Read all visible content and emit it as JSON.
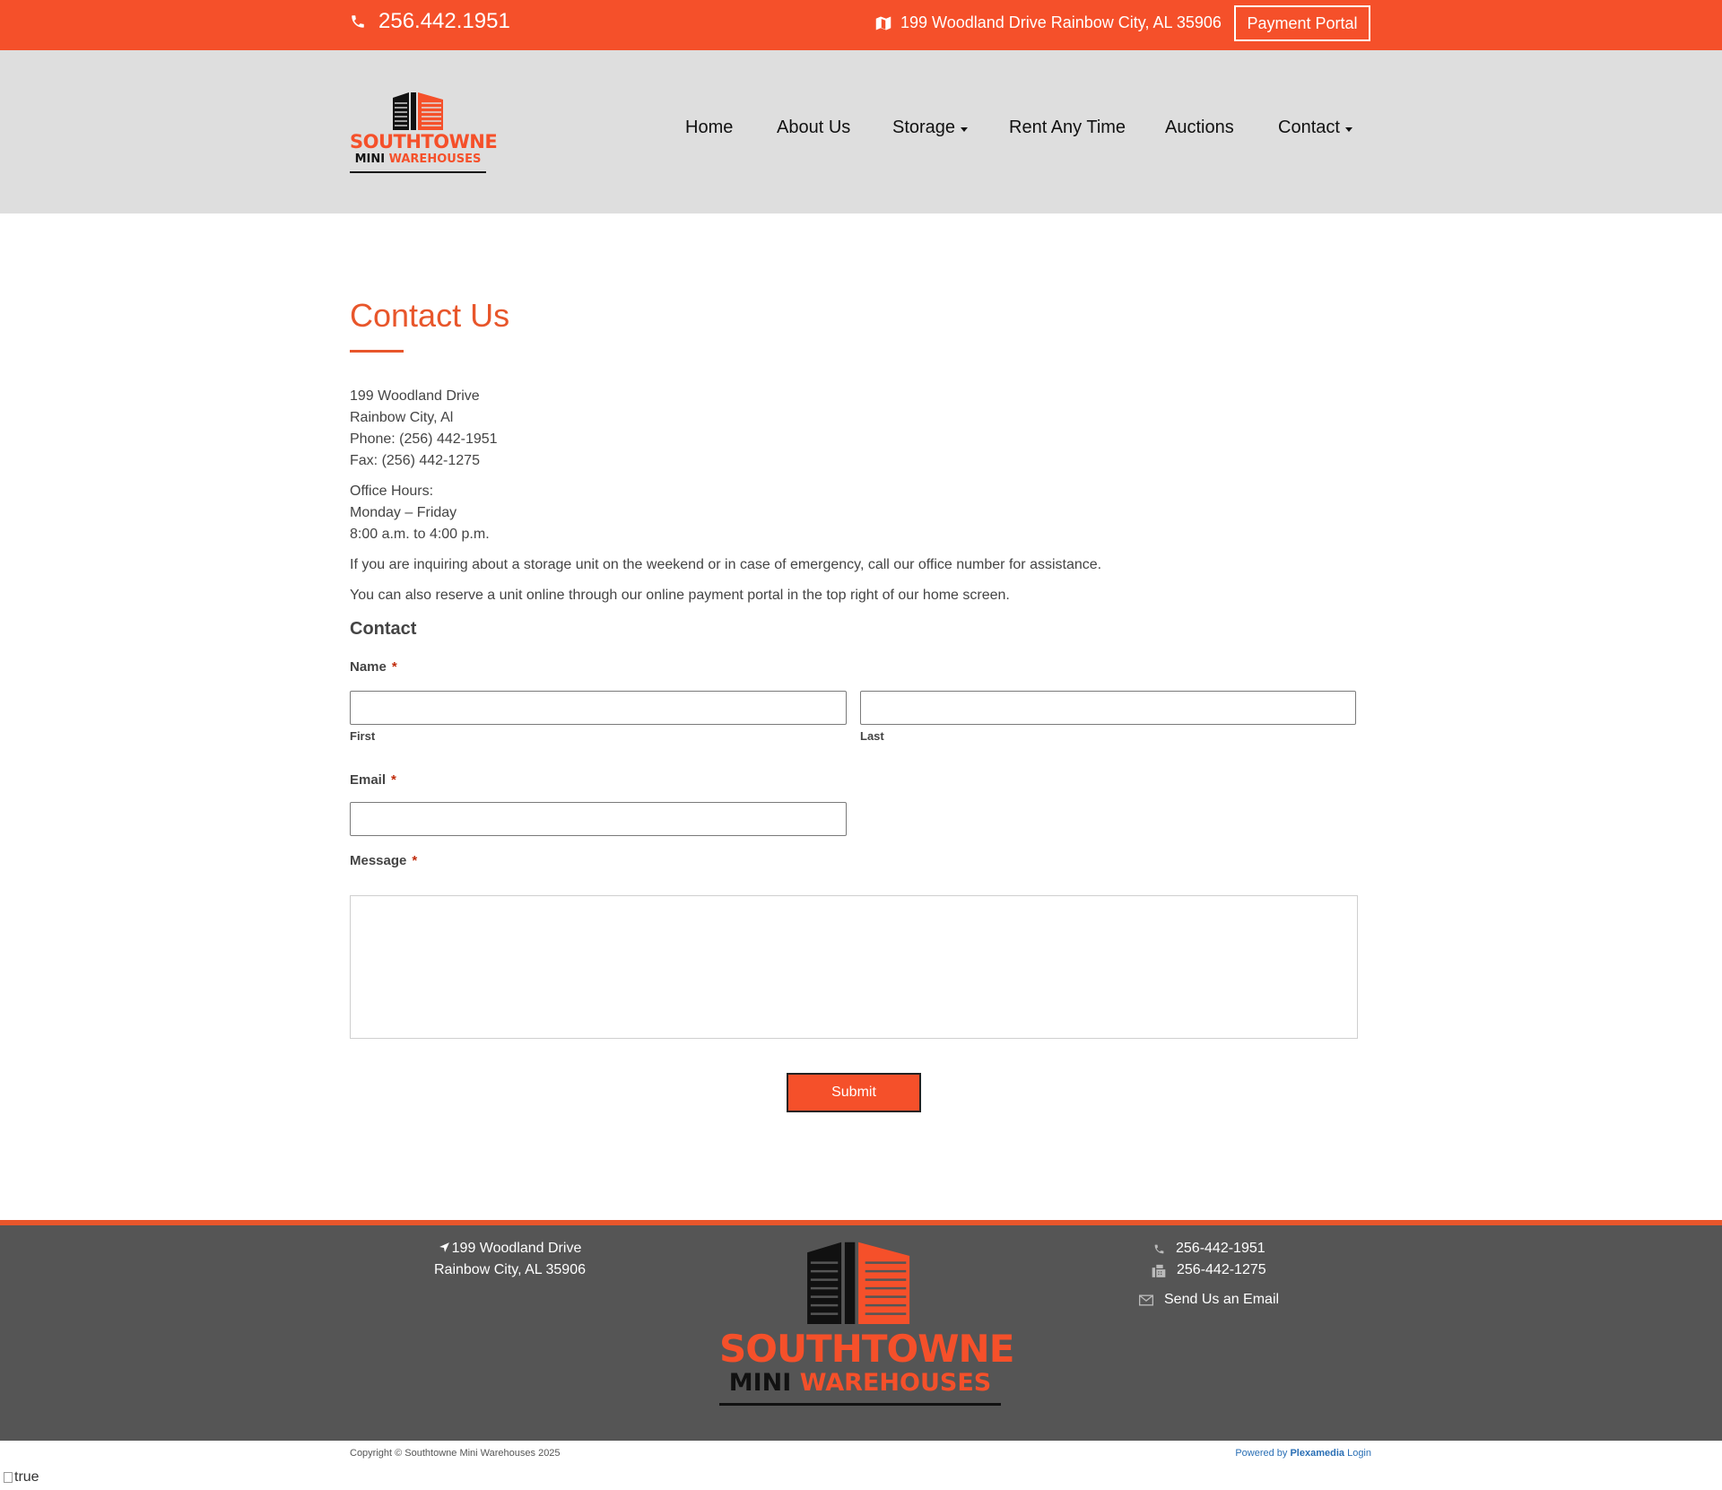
{
  "topbar": {
    "phone": "256.442.1951",
    "address": "199 Woodland Drive Rainbow City, AL 35906",
    "payment_portal": "Payment Portal"
  },
  "logo": {
    "line1": "SOUTHTOWNE",
    "line2a": "MINI",
    "line2b": "WAREHOUSES"
  },
  "nav": {
    "items": [
      {
        "label": "Home",
        "dropdown": false
      },
      {
        "label": "About Us",
        "dropdown": false
      },
      {
        "label": "Storage",
        "dropdown": true
      },
      {
        "label": "Rent Any Time",
        "dropdown": false
      },
      {
        "label": "Auctions",
        "dropdown": false
      },
      {
        "label": "Contact",
        "dropdown": true
      }
    ]
  },
  "main": {
    "title": "Contact Us",
    "address_line1": "199 Woodland Drive",
    "address_line2": "Rainbow City, Al",
    "phone": "Phone: (256) 442-1951",
    "fax": "Fax: (256) 442-1275",
    "hours_label": "Office Hours:",
    "hours_days": "Monday – Friday",
    "hours_time": "8:00 a.m. to 4:00 p.m.",
    "note1": "If you are inquiring about a storage unit on the weekend or in case of emergency, call our office number for assistance.",
    "note2": "You can also reserve a unit online through our online payment portal in the top right of our home screen."
  },
  "form": {
    "heading": "Contact",
    "name_label": "Name",
    "required_mark": "*",
    "first_label": "First",
    "last_label": "Last",
    "email_label": "Email",
    "message_label": "Message",
    "first_value": "",
    "last_value": "",
    "email_value": "",
    "message_value": "",
    "submit_label": "Submit"
  },
  "footer": {
    "address_line1": "199 Woodland Drive",
    "address_line2": "Rainbow City, AL 35906",
    "phone": "256-442-1951",
    "fax": "256-442-1275",
    "email_link": "Send Us an Email",
    "copyright": "Copyright © Southtowne Mini Warehouses 2025",
    "powered_prefix": "Powered by",
    "powered_brand": "Plexamedia",
    "login": "Login",
    "broken_image_alt": "true"
  },
  "colors": {
    "brand_orange": "#f5502a",
    "header_gray": "#dedede",
    "footer_gray": "#555555"
  }
}
